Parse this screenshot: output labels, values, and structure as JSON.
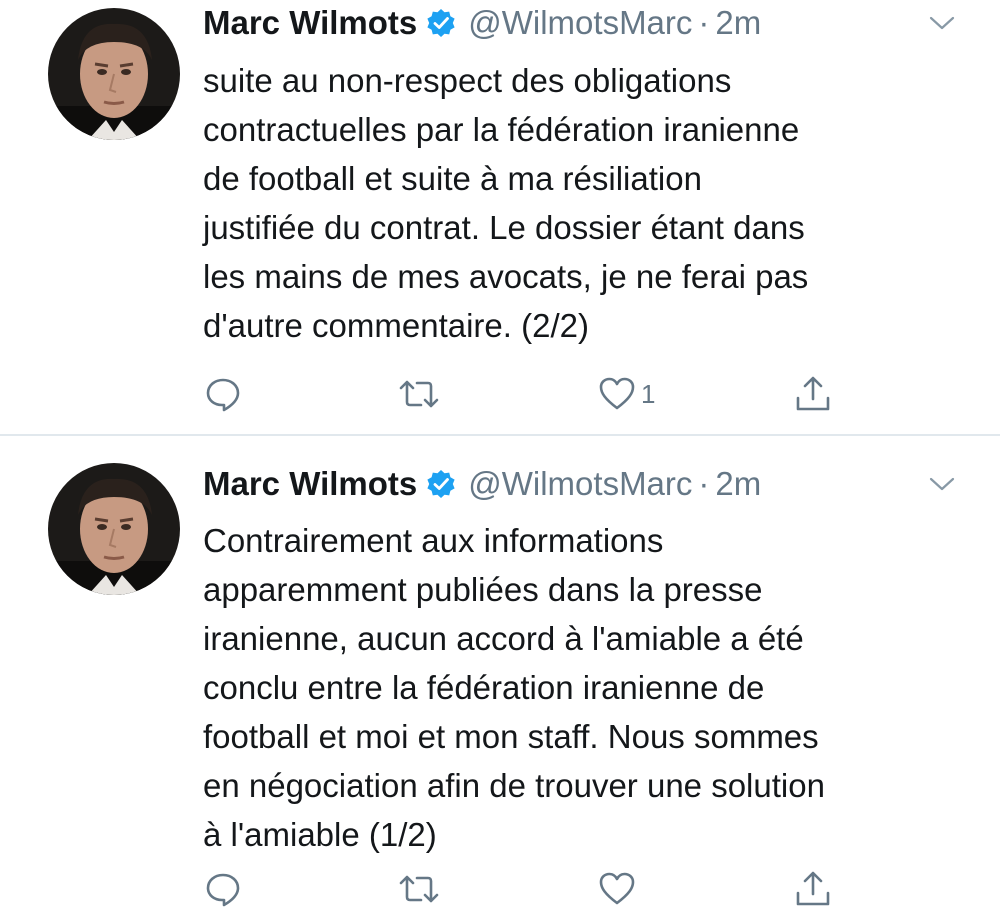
{
  "tweets": [
    {
      "author": {
        "name": "Marc Wilmots",
        "handle": "@WilmotsMarc",
        "verified": true
      },
      "separator": "·",
      "time": "2m",
      "text_lines": [
        "suite au non-respect des obligations",
        "contractuelles par la fédération iranienne",
        "de football et suite à ma résiliation",
        "justifiée du contrat. Le dossier étant dans",
        "les mains de mes avocats, je ne ferai pas",
        "d'autre commentaire. (2/2)"
      ],
      "actions": {
        "reply_icon": "reply-icon",
        "retweet_icon": "retweet-icon",
        "like_icon": "heart-icon",
        "like_count": "1",
        "share_icon": "share-icon"
      }
    },
    {
      "author": {
        "name": "Marc Wilmots",
        "handle": "@WilmotsMarc",
        "verified": true
      },
      "separator": "·",
      "time": "2m",
      "text_lines": [
        "Contrairement aux informations",
        "apparemment publiées dans la presse",
        "iranienne, aucun accord à l'amiable a été",
        "conclu entre la fédération iranienne de",
        "football et moi et mon staff. Nous sommes",
        "en négociation afin de trouver une solution",
        "à l'amiable (1/2)"
      ],
      "actions": {
        "reply_icon": "reply-icon",
        "retweet_icon": "retweet-icon",
        "like_icon": "heart-icon",
        "like_count": "",
        "share_icon": "share-icon"
      }
    }
  ],
  "colors": {
    "text": "#14171a",
    "secondary": "#657786",
    "verified_blue": "#1da1f2",
    "divider": "#e1e8ed"
  }
}
